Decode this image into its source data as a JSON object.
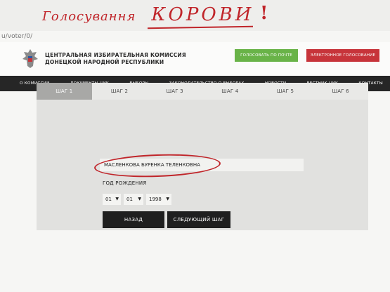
{
  "caption": {
    "text_small": "Голосування",
    "text_big": "Корови",
    "exclaim": "!"
  },
  "browser": {
    "url": "u/voter/0/"
  },
  "header": {
    "org_line1": "ЦЕНТРАЛЬНАЯ ИЗБИРАТЕЛЬНАЯ КОМИССИЯ",
    "org_line2": "ДОНЕЦКОЙ НАРОДНОЙ РЕСПУБЛИКИ",
    "btn_post": "ГОЛОСОВАТЬ ПО ПОЧТЕ",
    "btn_evote": "ЭЛЕКТРОННОЕ ГОЛОСОВАНИЕ",
    "emblem_icon": "eagle-emblem-icon"
  },
  "nav": {
    "items": [
      "О КОМИССИИ",
      "ДОКУМЕНТЫ ЦИК",
      "ВЫБОРЫ",
      "ЗАКОНОДАТЕЛЬСТВО О ВЫБОРАХ",
      "НОВОСТИ",
      "ВЕСТНИК ЦИК",
      "КОНТАКТЫ"
    ]
  },
  "wizard": {
    "tabs": [
      "ШАГ 1",
      "ШАГ 2",
      "ШАГ 3",
      "ШАГ 4",
      "ШАГ 5",
      "ШАГ 6"
    ],
    "active_tab": 0,
    "name_value": "МАСЛЕНКОВА БУРЕНКА ТЕЛЕНКОВНА",
    "dob_label": "ГОД РОЖДЕНИЯ",
    "day": "01",
    "month": "01",
    "year": "1998",
    "back_label": "НАЗАД",
    "next_label": "СЛЕДУЮЩИЙ ШАГ"
  },
  "colors": {
    "post_button": "#69b348",
    "evote_button": "#c7343a",
    "navbar": "#262626",
    "annotation": "#c0252a"
  }
}
